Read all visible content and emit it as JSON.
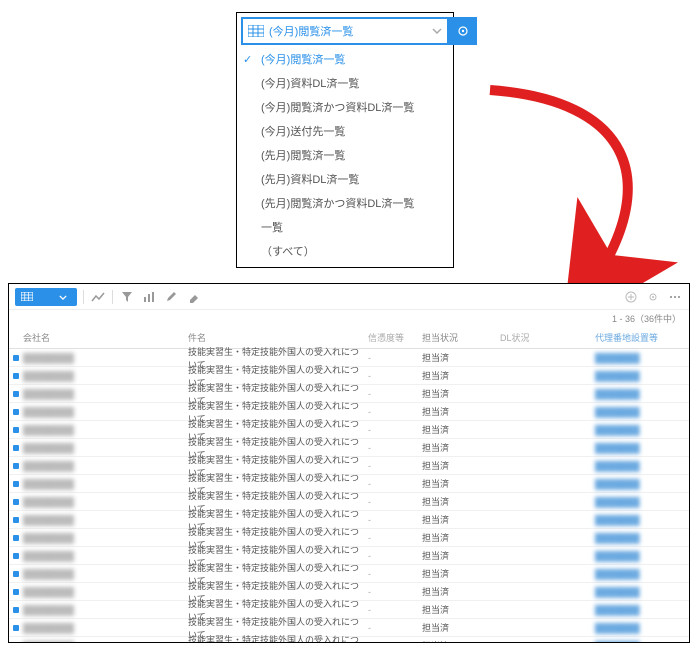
{
  "dropdown": {
    "selected": "(今月)閲覧済一覧",
    "options": [
      "(今月)閲覧済一覧",
      "(今月)資料DL済一覧",
      "(今月)閲覧済かつ資料DL済一覧",
      "(今月)送付先一覧",
      "(先月)閲覧済一覧",
      "(先月)資料DL済一覧",
      "(先月)閲覧済かつ資料DL済一覧",
      "一覧",
      "（すべて）"
    ]
  },
  "toolbar": {
    "count_label": "1 - 36（36件中）"
  },
  "table": {
    "headers": {
      "company": "会社名",
      "item": "件名",
      "rank": "信憑度等",
      "status": "担当状況",
      "dl": "DL状況",
      "phone": "代理番地設置等"
    },
    "rows": [
      {
        "company": "████████",
        "item": "技能実習生・特定技能外国人の受入れについて",
        "rank": "-",
        "status": "担当済",
        "phone": "███████"
      },
      {
        "company": "████████",
        "item": "技能実習生・特定技能外国人の受入れについて",
        "rank": "-",
        "status": "担当済",
        "phone": "███████"
      },
      {
        "company": "████████",
        "item": "技能実習生・特定技能外国人の受入れについて",
        "rank": "-",
        "status": "担当済",
        "phone": "███████"
      },
      {
        "company": "████████",
        "item": "技能実習生・特定技能外国人の受入れについて",
        "rank": "-",
        "status": "担当済",
        "phone": "███████"
      },
      {
        "company": "████████",
        "item": "技能実習生・特定技能外国人の受入れについて",
        "rank": "-",
        "status": "担当済",
        "phone": "███████"
      },
      {
        "company": "████████",
        "item": "技能実習生・特定技能外国人の受入れについて",
        "rank": "-",
        "status": "担当済",
        "phone": "███████"
      },
      {
        "company": "████████",
        "item": "技能実習生・特定技能外国人の受入れについて",
        "rank": "-",
        "status": "担当済",
        "phone": "███████"
      },
      {
        "company": "████████",
        "item": "技能実習生・特定技能外国人の受入れについて",
        "rank": "-",
        "status": "担当済",
        "phone": "███████"
      },
      {
        "company": "████████",
        "item": "技能実習生・特定技能外国人の受入れについて",
        "rank": "-",
        "status": "担当済",
        "phone": "███████"
      },
      {
        "company": "████████",
        "item": "技能実習生・特定技能外国人の受入れについて",
        "rank": "-",
        "status": "担当済",
        "phone": "███████"
      },
      {
        "company": "████████",
        "item": "技能実習生・特定技能外国人の受入れについて",
        "rank": "-",
        "status": "担当済",
        "phone": "███████"
      },
      {
        "company": "████████",
        "item": "技能実習生・特定技能外国人の受入れについて",
        "rank": "-",
        "status": "担当済",
        "phone": "███████"
      },
      {
        "company": "████████",
        "item": "技能実習生・特定技能外国人の受入れについて",
        "rank": "-",
        "status": "担当済",
        "phone": "███████"
      },
      {
        "company": "████████",
        "item": "技能実習生・特定技能外国人の受入れについて",
        "rank": "-",
        "status": "担当済",
        "phone": "███████"
      },
      {
        "company": "████████",
        "item": "技能実習生・特定技能外国人の受入れについて",
        "rank": "-",
        "status": "担当済",
        "phone": "███████"
      },
      {
        "company": "████████",
        "item": "技能実習生・特定技能外国人の受入れについて",
        "rank": "-",
        "status": "担当済",
        "phone": "███████"
      },
      {
        "company": "████████",
        "item": "技能実習生・特定技能外国人の受入れについて",
        "rank": "-",
        "status": "担当済",
        "phone": "███████"
      }
    ]
  }
}
